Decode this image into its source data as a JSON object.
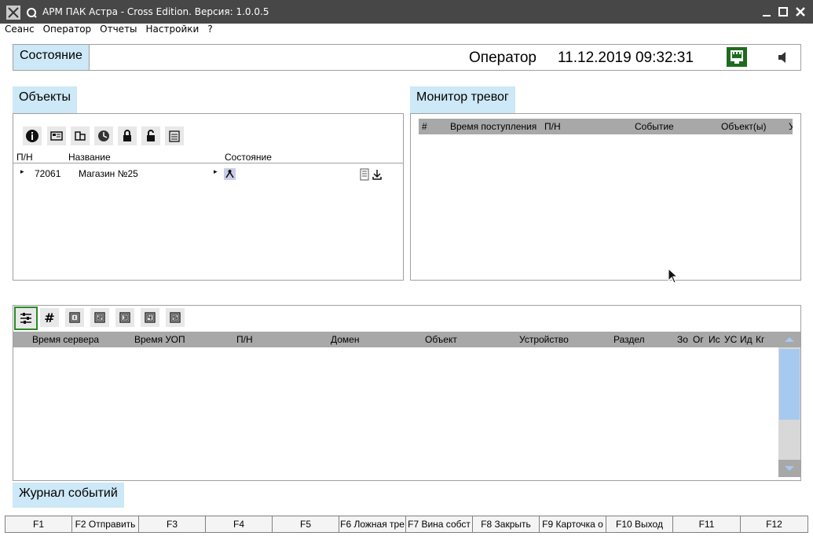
{
  "window": {
    "title": "АРМ ПАК Астра - Cross Edition. Версия: 1.0.0.5"
  },
  "menu": [
    "Сеанс",
    "Оператор",
    "Отчеты",
    "Настройки",
    "?"
  ],
  "status": {
    "label": "Состояние",
    "operator": "Оператор",
    "datetime": "11.12.2019 09:32:31"
  },
  "objects": {
    "label": "Объекты",
    "columns": {
      "pn": "П/Н",
      "name": "Название",
      "state": "Состояние"
    },
    "rows": [
      {
        "pn": "72061",
        "name": "Магазин №25"
      }
    ]
  },
  "alarms": {
    "label": "Монитор тревог",
    "columns": [
      "#",
      "Время поступления",
      "П/Н",
      "Событие",
      "Объект(ы)",
      "У"
    ]
  },
  "events": {
    "tool_buttons": [
      "#"
    ],
    "columns": [
      "Время сервера",
      "Время УОП",
      "П/Н",
      "Домен",
      "Объект",
      "Устройство",
      "Раздел",
      "Зо",
      "Ог",
      "Ис",
      "УС",
      "Ид",
      "Кг"
    ],
    "label": "Журнал событий"
  },
  "fkeys": [
    "F1",
    "F2 Отправить",
    "F3",
    "F4",
    "F5",
    "F6 Ложная тре",
    "F7 Вина собст",
    "F8 Закрыть",
    "F9 Карточка о",
    "F10 Выход",
    "F11",
    "F12"
  ],
  "colors": {
    "titlebar": "#474747",
    "tab": "#cde8f6",
    "header": "#a8a8a8",
    "scroll_thumb": "#a6c9ef",
    "active_tool": "#2a8a2a"
  }
}
